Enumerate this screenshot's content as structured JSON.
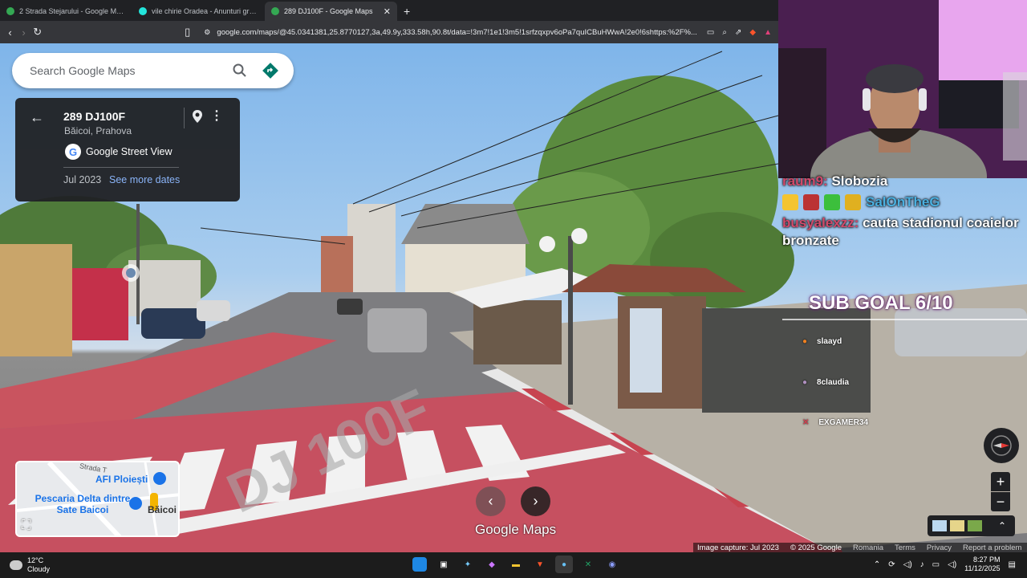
{
  "tabs": [
    {
      "title": "2 Strada Stejarului - Google Maps",
      "icon": "maps-icon",
      "active": false
    },
    {
      "title": "vile chirie Oradea - Anunturi gratuite",
      "icon": "olx-icon",
      "active": false
    },
    {
      "title": "289 DJ100F - Google Maps",
      "icon": "maps-icon",
      "active": true
    }
  ],
  "browser": {
    "url": "google.com/maps/@45.0341381,25.8770127,3a,49.9y,333.58h,90.8t/data=!3m7!1e1!3m5!1srfzqxpv6oPa7quICBuHWwA!2e0!6shttps:%2F%..."
  },
  "search": {
    "placeholder": "Search Google Maps"
  },
  "card": {
    "address": "289 DJ100F",
    "locality": "Băicoi, Prahova",
    "source": "Google Street View",
    "date": "Jul 2023",
    "see_more": "See more dates"
  },
  "chat": {
    "line1_user": "raum9:",
    "line1_msg": "Slobozia",
    "line2_text": "SalOnTheG",
    "line3_user": "busyalexzz:",
    "line3_msg": "cauta stadionul coaielor bronzate"
  },
  "subgoal": "SUB GOAL 6/10",
  "subs": [
    "slaayd",
    "8claudia",
    "EXGAMER34"
  ],
  "minimap": {
    "street": "Strada T",
    "place1": "AFI Ploiești",
    "place2": "Pescaria Delta dintre Sate Baicoi",
    "place3": "Băicoi"
  },
  "logo": "Google Maps",
  "footer": {
    "capture": "Image capture: Jul 2023",
    "copyright": "© 2025 Google",
    "country": "Romania",
    "terms": "Terms",
    "privacy": "Privacy",
    "report": "Report a problem"
  },
  "taskbar": {
    "temp": "12°C",
    "condition": "Cloudy",
    "time": "8:27 PM",
    "date": "11/12/2025"
  },
  "colors": {
    "accent": "#1a73e8",
    "directions": "#00796b",
    "crosswalk_red": "#d05060"
  }
}
